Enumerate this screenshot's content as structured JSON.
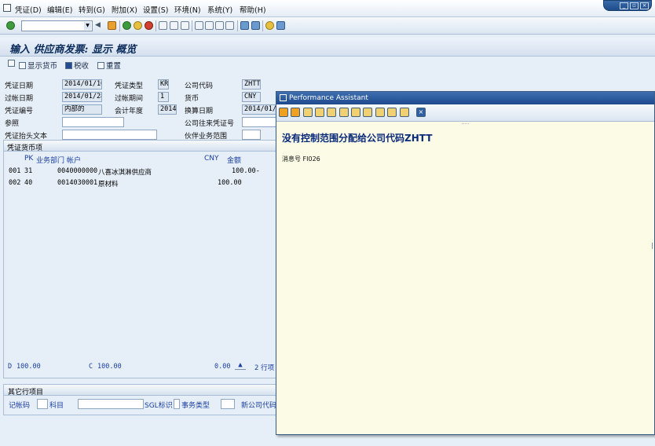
{
  "menu": [
    "凭证(D)",
    "编辑(E)",
    "转到(G)",
    "附加(X)",
    "设置(S)",
    "环境(N)",
    "系统(Y)",
    "帮助(H)"
  ],
  "screen_title": "输入 供应商发票: 显示 概览",
  "app_toolbar": {
    "display_currency": "显示货币",
    "tax": "税收",
    "reset": "重置"
  },
  "header": {
    "doc_date_label": "凭证日期",
    "doc_date": "2014/01/10",
    "doc_type_label": "凭证类型",
    "doc_type": "KR",
    "company_code_label": "公司代码",
    "company_code": "ZHTT",
    "posting_date_label": "过帐日期",
    "posting_date": "2014/01/28",
    "period_label": "过帐期间",
    "period": "1",
    "currency_label": "货币",
    "currency": "CNY",
    "doc_number_label": "凭证编号",
    "doc_number": "内部的",
    "fiscal_year_label": "会计年度",
    "fiscal_year": "2014",
    "translation_date_label": "换算日期",
    "translation_date": "2014/01/2",
    "reference_label": "参照",
    "reference": "",
    "intercompany_label": "公司往来凭证号",
    "intercompany": "",
    "header_text_label": "凭证抬头文本",
    "header_text": "",
    "trading_partner_label": "伙伴业务范围",
    "trading_partner": ""
  },
  "items": {
    "section_title": "凭证货币项",
    "columns": {
      "pk": "PK",
      "bus_area": "业务部门",
      "account": "帐户",
      "currency": "CNY",
      "amount": "金额"
    },
    "rows": [
      {
        "item": "001",
        "pk": "31",
        "account": "0040000000",
        "desc": "八喜冰淇淋供应商",
        "amount": "100.00-"
      },
      {
        "item": "002",
        "pk": "40",
        "account": "0014030001",
        "desc": "原材料",
        "amount": "100.00"
      }
    ],
    "debit_label": "D",
    "debit": "100.00",
    "credit_label": "C",
    "credit": "100.00",
    "balance": "0.00",
    "line_count": "2 行项"
  },
  "other_items": {
    "title": "其它行项目",
    "posting_key_label": "记帐码",
    "account_label": "科目",
    "sgl_label": "SGL标识",
    "trans_type_label": "事务类型",
    "new_company_label": "新公司代码"
  },
  "performance_assistant": {
    "title": "Performance Assistant",
    "heading": "没有控制范围分配给公司代码ZHTT",
    "message": "消息号 FI026"
  }
}
